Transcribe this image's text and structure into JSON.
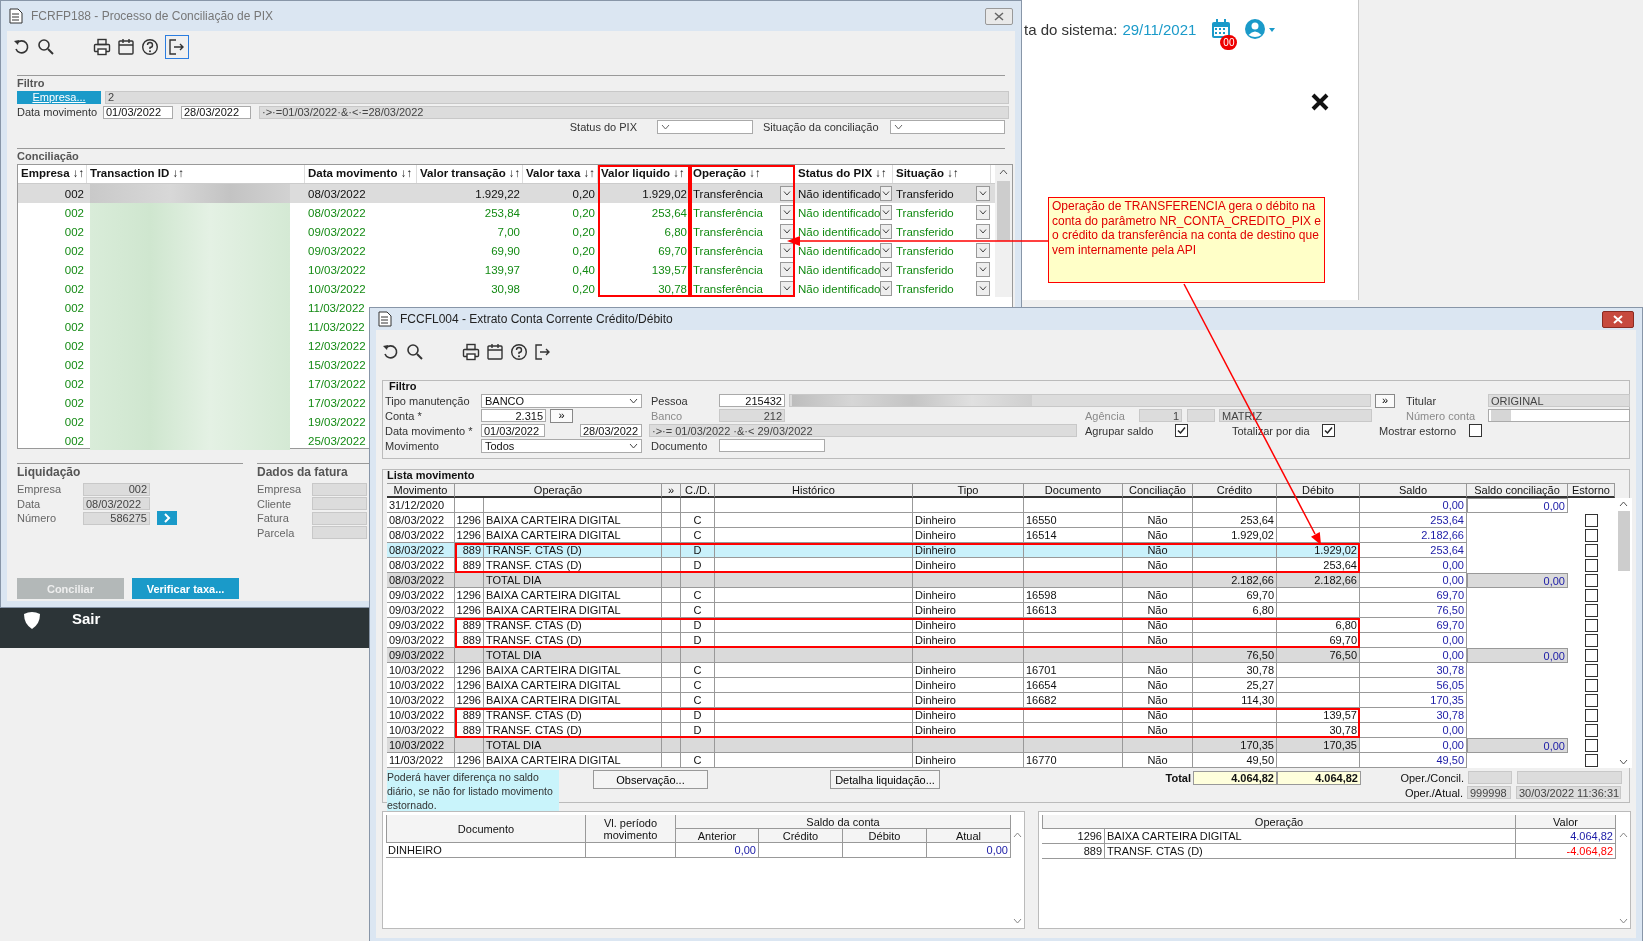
{
  "background": {
    "system_date_label": "ta do sistema:",
    "system_date": "29/11/2021",
    "notification_count": "00",
    "menu_item": "Sair"
  },
  "pix_window": {
    "title": "FCRFP188 - Processo de Conciliação de PIX",
    "filter": {
      "title": "Filtro",
      "company_button": "Empresa...",
      "company_value": "2",
      "date_label": "Data movimento",
      "date_from": "01/03/2022",
      "date_to": "28/03/2022",
      "date_expression": "·>·=01/03/2022·&·<·=28/03/2022",
      "pix_status_label": "Status do PIX",
      "reconciliation_status_label": "Situação da conciliação"
    },
    "conciliation": {
      "title": "Conciliação",
      "columns": [
        {
          "label": "Empresa ↓↑",
          "highlighted": false
        },
        {
          "label": "Transaction ID ↓↑",
          "highlighted": false
        },
        {
          "label": "Data movimento ↓↑",
          "highlighted": false
        },
        {
          "label": "Valor transação ↓↑",
          "highlighted": false
        },
        {
          "label": "Valor taxa ↓↑",
          "highlighted": false
        },
        {
          "label": "Valor liquido ↓↑",
          "highlighted": true
        },
        {
          "label": "Operação ↓↑",
          "highlighted": true
        },
        {
          "label": "Status do PIX ↓↑",
          "highlighted": false
        },
        {
          "label": "Situação ↓↑",
          "highlighted": false
        }
      ],
      "rows": [
        {
          "selected": true,
          "empresa": "002",
          "data_movimento": "08/03/2022",
          "valor_transacao": "1.929,22",
          "valor_taxa": "0,20",
          "valor_liquido": "1.929,02",
          "operacao": "Transferência",
          "status_pix": "Não identificado",
          "situacao": "Transferido"
        },
        {
          "selected": false,
          "empresa": "002",
          "data_movimento": "08/03/2022",
          "valor_transacao": "253,84",
          "valor_taxa": "0,20",
          "valor_liquido": "253,64",
          "operacao": "Transferência",
          "status_pix": "Não identificado",
          "situacao": "Transferido"
        },
        {
          "selected": false,
          "empresa": "002",
          "data_movimento": "09/03/2022",
          "valor_transacao": "7,00",
          "valor_taxa": "0,20",
          "valor_liquido": "6,80",
          "operacao": "Transferência",
          "status_pix": "Não identificado",
          "situacao": "Transferido"
        },
        {
          "selected": false,
          "empresa": "002",
          "data_movimento": "09/03/2022",
          "valor_transacao": "69,90",
          "valor_taxa": "0,20",
          "valor_liquido": "69,70",
          "operacao": "Transferência",
          "status_pix": "Não identificado",
          "situacao": "Transferido"
        },
        {
          "selected": false,
          "empresa": "002",
          "data_movimento": "10/03/2022",
          "valor_transacao": "139,97",
          "valor_taxa": "0,40",
          "valor_liquido": "139,57",
          "operacao": "Transferência",
          "status_pix": "Não identificado",
          "situacao": "Transferido"
        },
        {
          "selected": false,
          "empresa": "002",
          "data_movimento": "10/03/2022",
          "valor_transacao": "30,98",
          "valor_taxa": "0,20",
          "valor_liquido": "30,78",
          "operacao": "Transferência",
          "status_pix": "Não identificado",
          "situacao": "Transferido"
        },
        {
          "selected": false,
          "empresa": "002",
          "data_movimento": "11/03/2022"
        },
        {
          "selected": false,
          "empresa": "002",
          "data_movimento": "11/03/2022"
        },
        {
          "selected": false,
          "empresa": "002",
          "data_movimento": "12/03/2022"
        },
        {
          "selected": false,
          "empresa": "002",
          "data_movimento": "15/03/2022"
        },
        {
          "selected": false,
          "empresa": "002",
          "data_movimento": "17/03/2022"
        },
        {
          "selected": false,
          "empresa": "002",
          "data_movimento": "17/03/2022"
        },
        {
          "selected": false,
          "empresa": "002",
          "data_movimento": "19/03/2022"
        },
        {
          "selected": false,
          "empresa": "002",
          "data_movimento": "25/03/2022"
        }
      ]
    },
    "settlement": {
      "title": "Liquidação",
      "fields": [
        {
          "label": "Empresa",
          "value": "002"
        },
        {
          "label": "Data",
          "value": "08/03/2022"
        },
        {
          "label": "Número",
          "value": "586275"
        }
      ]
    },
    "invoice": {
      "title": "Dados da fatura",
      "fields": [
        {
          "label": "Empresa"
        },
        {
          "label": "Cliente"
        },
        {
          "label": "Fatura"
        },
        {
          "label": "Parcela"
        }
      ]
    },
    "buttons": [
      {
        "label": "Conciliar",
        "disabled": true
      },
      {
        "label": "Verificar taxa...",
        "disabled": false
      }
    ]
  },
  "annotation": {
    "text": "Operação de TRANSFERENCIA gera o débito na conta do parâmetro NR_CONTA_CREDITO_PIX e o crédito da transferência na conta de destino que vem internamente pela API"
  },
  "statement_window": {
    "title": "FCCFL004 - Extrato Conta Corrente Crédito/Débito",
    "filter": {
      "title": "Filtro",
      "maintenance_type_label": "Tipo manutenção",
      "maintenance_type": "BANCO",
      "account_label": "Conta *",
      "account": "2.315",
      "account_button": "»",
      "date_label": "Data movimento *",
      "date_from": "01/03/2022",
      "date_to": "28/03/2022",
      "date_expression": "·>·= 01/03/2022 ·&·< 29/03/2022",
      "movement_label": "Movimento",
      "movement": "Todos",
      "person_label": "Pessoa",
      "person": "215432",
      "person_button": "»",
      "bank_label": "Banco",
      "bank": "212",
      "document_label": "Documento",
      "branch_label": "Agência",
      "branch": "1",
      "branch_name": "MATRIZ",
      "holder_label": "Titular",
      "holder": "ORIGINAL",
      "account_number_label": "Número conta",
      "options": [
        {
          "label": "Agrupar saldo",
          "checked": true
        },
        {
          "label": "Totalizar por dia",
          "checked": true
        },
        {
          "label": "Mostrar estorno",
          "checked": false
        }
      ]
    },
    "list": {
      "title": "Lista movimento",
      "columns": [
        "Movimento",
        "Operação",
        "»",
        "C./D.",
        "Histórico",
        "Tipo",
        "Documento",
        "Conciliação",
        "Crédito",
        "Débito",
        "Saldo",
        "Saldo conciliação",
        "Estorno"
      ],
      "rows": [
        {
          "kind": "opening",
          "selected": false,
          "highlighted": false,
          "date": "31/12/2020",
          "balance": "0,00",
          "reconciliation_balance": "0,00"
        },
        {
          "kind": "entry",
          "selected": false,
          "highlighted": false,
          "checked": false,
          "date": "08/03/2022",
          "code": "1296",
          "operation": "BAIXA CARTEIRA DIGITAL",
          "cd": "C",
          "type": "Dinheiro",
          "document": "16550",
          "reconciled": "Não",
          "credit": "253,64",
          "balance": "253,64"
        },
        {
          "kind": "entry",
          "selected": false,
          "highlighted": false,
          "checked": false,
          "date": "08/03/2022",
          "code": "1296",
          "operation": "BAIXA CARTEIRA DIGITAL",
          "cd": "C",
          "type": "Dinheiro",
          "document": "16514",
          "reconciled": "Não",
          "credit": "1.929,02",
          "balance": "2.182,66"
        },
        {
          "kind": "entry",
          "selected": true,
          "highlighted": true,
          "checked": false,
          "date": "08/03/2022",
          "code": "889",
          "operation": "TRANSF. CTAS (D)",
          "cd": "D",
          "type": "Dinheiro",
          "reconciled": "Não",
          "debit": "1.929,02",
          "balance": "253,64"
        },
        {
          "kind": "entry",
          "selected": false,
          "highlighted": true,
          "checked": false,
          "date": "08/03/2022",
          "code": "889",
          "operation": "TRANSF. CTAS (D)",
          "cd": "D",
          "type": "Dinheiro",
          "reconciled": "Não",
          "debit": "253,64",
          "balance": "0,00"
        },
        {
          "kind": "total",
          "selected": false,
          "highlighted": false,
          "checked": false,
          "date": "08/03/2022",
          "operation": "TOTAL DIA",
          "credit": "2.182,66",
          "debit": "2.182,66",
          "balance": "0,00",
          "reconciliation_balance": "0,00"
        },
        {
          "kind": "entry",
          "selected": false,
          "highlighted": false,
          "checked": false,
          "date": "09/03/2022",
          "code": "1296",
          "operation": "BAIXA CARTEIRA DIGITAL",
          "cd": "C",
          "type": "Dinheiro",
          "document": "16598",
          "reconciled": "Não",
          "credit": "69,70",
          "balance": "69,70"
        },
        {
          "kind": "entry",
          "selected": false,
          "highlighted": false,
          "checked": false,
          "date": "09/03/2022",
          "code": "1296",
          "operation": "BAIXA CARTEIRA DIGITAL",
          "cd": "C",
          "type": "Dinheiro",
          "document": "16613",
          "reconciled": "Não",
          "credit": "6,80",
          "balance": "76,50"
        },
        {
          "kind": "entry",
          "selected": false,
          "highlighted": true,
          "checked": false,
          "date": "09/03/2022",
          "code": "889",
          "operation": "TRANSF. CTAS (D)",
          "cd": "D",
          "type": "Dinheiro",
          "reconciled": "Não",
          "debit": "6,80",
          "balance": "69,70"
        },
        {
          "kind": "entry",
          "selected": false,
          "highlighted": true,
          "checked": false,
          "date": "09/03/2022",
          "code": "889",
          "operation": "TRANSF. CTAS (D)",
          "cd": "D",
          "type": "Dinheiro",
          "reconciled": "Não",
          "debit": "69,70",
          "balance": "0,00"
        },
        {
          "kind": "total",
          "selected": false,
          "highlighted": false,
          "checked": false,
          "date": "09/03/2022",
          "operation": "TOTAL DIA",
          "credit": "76,50",
          "debit": "76,50",
          "balance": "0,00",
          "reconciliation_balance": "0,00"
        },
        {
          "kind": "entry",
          "selected": false,
          "highlighted": false,
          "checked": false,
          "date": "10/03/2022",
          "code": "1296",
          "operation": "BAIXA CARTEIRA DIGITAL",
          "cd": "C",
          "type": "Dinheiro",
          "document": "16701",
          "reconciled": "Não",
          "credit": "30,78",
          "balance": "30,78"
        },
        {
          "kind": "entry",
          "selected": false,
          "highlighted": false,
          "checked": false,
          "date": "10/03/2022",
          "code": "1296",
          "operation": "BAIXA CARTEIRA DIGITAL",
          "cd": "C",
          "type": "Dinheiro",
          "document": "16654",
          "reconciled": "Não",
          "credit": "25,27",
          "balance": "56,05"
        },
        {
          "kind": "entry",
          "selected": false,
          "highlighted": false,
          "checked": false,
          "date": "10/03/2022",
          "code": "1296",
          "operation": "BAIXA CARTEIRA DIGITAL",
          "cd": "C",
          "type": "Dinheiro",
          "document": "16682",
          "reconciled": "Não",
          "credit": "114,30",
          "balance": "170,35"
        },
        {
          "kind": "entry",
          "selected": false,
          "highlighted": true,
          "checked": false,
          "date": "10/03/2022",
          "code": "889",
          "operation": "TRANSF. CTAS (D)",
          "cd": "D",
          "type": "Dinheiro",
          "reconciled": "Não",
          "debit": "139,57",
          "balance": "30,78"
        },
        {
          "kind": "entry",
          "selected": false,
          "highlighted": true,
          "checked": false,
          "date": "10/03/2022",
          "code": "889",
          "operation": "TRANSF. CTAS (D)",
          "cd": "D",
          "type": "Dinheiro",
          "reconciled": "Não",
          "debit": "30,78",
          "balance": "0,00"
        },
        {
          "kind": "total",
          "selected": false,
          "highlighted": false,
          "checked": false,
          "date": "10/03/2022",
          "operation": "TOTAL DIA",
          "credit": "170,35",
          "debit": "170,35",
          "balance": "0,00",
          "reconciliation_balance": "0,00"
        },
        {
          "kind": "entry",
          "selected": false,
          "highlighted": false,
          "checked": false,
          "date": "11/03/2022",
          "code": "1296",
          "operation": "BAIXA CARTEIRA DIGITAL",
          "cd": "C",
          "type": "Dinheiro",
          "document": "16770",
          "reconciled": "Não",
          "credit": "49,50",
          "balance": "49,50"
        }
      ]
    },
    "footer": {
      "note": "Poderá haver diferença no saldo diário, se não for listado movimento estornado.",
      "observation_button": "Observação...",
      "settlement_button": "Detalha liquidação...",
      "total_label": "Total",
      "total_credit": "4.064,82",
      "total_debit": "4.064,82",
      "oper_concil_label": "Oper./Concil.",
      "oper_update_label": "Oper./Atual.",
      "oper_update_user": "999998",
      "oper_update_time": "30/03/2022 11:36:31"
    },
    "balance": {
      "document_label": "Documento",
      "period_label": "Vl. período movimento",
      "group_label": "Saldo da conta",
      "previous_label": "Anterior",
      "credit_label": "Crédito",
      "debit_label": "Débito",
      "current_label": "Atual",
      "rows": [
        {
          "document": "DINHEIRO",
          "previous": "0,00",
          "current": "0,00"
        }
      ]
    },
    "operations": {
      "operation_label": "Operação",
      "value_label": "Valor",
      "rows": [
        {
          "code": "1296",
          "name": "BAIXA CARTEIRA DIGITAL",
          "value": "4.064,82",
          "color": "#1a1aa6"
        },
        {
          "code": "889",
          "name": "TRANSF. CTAS (D)",
          "value": "-4.064,82",
          "color": "#ff0000"
        }
      ]
    }
  }
}
